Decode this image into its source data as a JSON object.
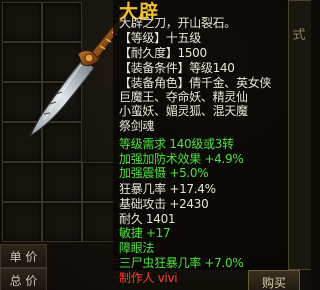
{
  "item": {
    "name": "大辟",
    "lines": [
      {
        "text": "大辟之刀，开山裂石。",
        "color": "white"
      },
      {
        "text": "【等级】十五级",
        "color": "white"
      },
      {
        "text": "【耐久度】1500",
        "color": "white"
      },
      {
        "text": "【装备条件】等级140",
        "color": "white"
      },
      {
        "text": "【装备角色】倩千金、英女侠",
        "color": "white"
      },
      {
        "text": "巨魔王、夺命妖、精灵仙",
        "color": "white"
      },
      {
        "text": "小蛮妖、媚灵狐、混天魔",
        "color": "white"
      },
      {
        "text": "祭剑魂",
        "color": "white"
      },
      {
        "text": "等级需求 140级或3转",
        "color": "green"
      },
      {
        "text": "加强加防术效果 +4.9%",
        "color": "green"
      },
      {
        "text": "加强震慑 +5.0%",
        "color": "green"
      },
      {
        "text": "狂暴几率 +17.4%",
        "color": "white"
      },
      {
        "text": "基础攻击 +2430",
        "color": "white"
      },
      {
        "text": "耐久 1401",
        "color": "white"
      },
      {
        "text": "敏捷 +17",
        "color": "green"
      },
      {
        "text": "障眼法",
        "color": "green"
      },
      {
        "text": "三尸虫狂暴几率 +7.0%",
        "color": "green"
      },
      {
        "text": "制作人 vivi",
        "color": "red"
      }
    ]
  },
  "background": {
    "side_char": "式",
    "unit_price_label": "单 价",
    "total_price_label": "总 价",
    "buy_label": "购买"
  },
  "colors": {
    "title": "#f0c030",
    "white": "#e8e4d6",
    "green": "#4ee040",
    "red": "#ff3a28"
  },
  "icons": {
    "weapon": "blade-weapon-icon"
  }
}
